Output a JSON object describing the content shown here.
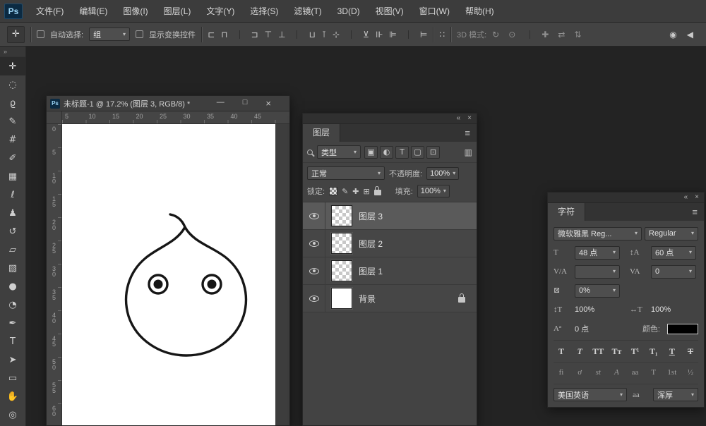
{
  "ui": {
    "caret": "▾",
    "collapse_icon": "«",
    "close_icon": "×",
    "menu_icon": "≡",
    "toolbar_collapse_icon": "»"
  },
  "menu_bar": {
    "logo": "Ps",
    "items": [
      {
        "label": "文件(F)",
        "dn": "menu-file"
      },
      {
        "label": "编辑(E)",
        "dn": "menu-edit"
      },
      {
        "label": "图像(I)",
        "dn": "menu-image"
      },
      {
        "label": "图层(L)",
        "dn": "menu-layer"
      },
      {
        "label": "文字(Y)",
        "dn": "menu-type"
      },
      {
        "label": "选择(S)",
        "dn": "menu-select"
      },
      {
        "label": "滤镜(T)",
        "dn": "menu-filter"
      },
      {
        "label": "3D(D)",
        "dn": "menu-3d"
      },
      {
        "label": "视图(V)",
        "dn": "menu-view"
      },
      {
        "label": "窗口(W)",
        "dn": "menu-window"
      },
      {
        "label": "帮助(H)",
        "dn": "menu-help"
      }
    ]
  },
  "options_bar": {
    "tool_icon": "✛",
    "auto_select_label": "自动选择:",
    "auto_select_value": "组",
    "show_transform_label": "显示变换控件",
    "align_icons": [
      {
        "glyph": "⊏",
        "dn": "align-left-edges-icon"
      },
      {
        "glyph": "⊓",
        "dn": "align-horizontal-centers-icon"
      },
      {
        "glyph": "⊐",
        "dn": "align-right-edges-icon"
      },
      {
        "glyph": "⊤",
        "dn": "align-top-edges-icon"
      },
      {
        "glyph": "⊥",
        "dn": "align-vertical-centers-icon"
      },
      {
        "glyph": "⊔",
        "dn": "align-bottom-edges-icon"
      },
      {
        "glyph": "⊺",
        "dn": "distribute-top-edges-icon"
      },
      {
        "glyph": "⊹",
        "dn": "distribute-vertical-centers-icon"
      },
      {
        "glyph": "⊻",
        "dn": "distribute-bottom-edges-icon"
      },
      {
        "glyph": "⊪",
        "dn": "distribute-left-edges-icon"
      },
      {
        "glyph": "⊫",
        "dn": "distribute-horizontal-centers-icon"
      },
      {
        "glyph": "⊨",
        "dn": "distribute-right-edges-icon"
      }
    ],
    "auto_align_icon": "∷",
    "mode_3d_label": "3D 模式:",
    "mode_3d_icons": [
      {
        "glyph": "↻",
        "dn": "3d-rotate-icon"
      },
      {
        "glyph": "⊙",
        "dn": "3d-roll-icon"
      },
      {
        "glyph": "✚",
        "dn": "3d-drag-icon"
      },
      {
        "glyph": "⇄",
        "dn": "3d-slide-icon"
      },
      {
        "glyph": "⇅",
        "dn": "3d-scale-icon"
      }
    ],
    "extra_icons": [
      {
        "glyph": "◉",
        "dn": "options-bar-extra-icon-1"
      },
      {
        "glyph": "◀",
        "dn": "options-bar-extra-icon-2"
      }
    ]
  },
  "toolbar": {
    "tools": [
      {
        "glyph": "✛",
        "dn": "move-tool",
        "cls": "active"
      },
      {
        "glyph": "◌",
        "dn": "elliptical-marquee-tool"
      },
      {
        "glyph": "ϱ",
        "dn": "lasso-tool"
      },
      {
        "glyph": "✎",
        "dn": "quick-selection-tool"
      },
      {
        "glyph": "#",
        "dn": "crop-tool"
      },
      {
        "glyph": "✐",
        "dn": "eyedropper-tool"
      },
      {
        "glyph": "▦",
        "dn": "spot-healing-brush-tool"
      },
      {
        "glyph": "ℓ",
        "dn": "brush-tool"
      },
      {
        "glyph": "♟",
        "dn": "clone-stamp-tool"
      },
      {
        "glyph": "↺",
        "dn": "history-brush-tool"
      },
      {
        "glyph": "▱",
        "dn": "eraser-tool"
      },
      {
        "glyph": "▧",
        "dn": "gradient-tool"
      },
      {
        "glyph": "●",
        "dn": "blur-tool"
      },
      {
        "glyph": "◔",
        "dn": "dodge-tool"
      },
      {
        "glyph": "✒",
        "dn": "pen-tool"
      },
      {
        "glyph": "T",
        "dn": "type-tool"
      },
      {
        "glyph": "➤",
        "dn": "path-selection-tool"
      },
      {
        "glyph": "▭",
        "dn": "rectangle-tool"
      },
      {
        "glyph": "✋",
        "dn": "hand-tool"
      },
      {
        "glyph": "◎",
        "dn": "zoom-tool"
      }
    ]
  },
  "document": {
    "icon": "Ps",
    "title": "未标题-1 @ 17.2% (图层 3, RGB/8) *",
    "minimize_icon": "—",
    "maximize_icon": "□",
    "close_icon": "×",
    "h_ruler": [
      "5",
      "10",
      "15",
      "20",
      "25",
      "30",
      "35",
      "40",
      "45"
    ],
    "v_ruler": [
      "0",
      "5",
      "10",
      "15",
      "20",
      "25",
      "30",
      "35",
      "40",
      "45",
      "50",
      "55",
      "60"
    ]
  },
  "layers_panel": {
    "tab": "图层",
    "filter_label": "类型",
    "filter_icons": [
      {
        "glyph": "▣",
        "dn": "filter-pixel-layers-icon"
      },
      {
        "glyph": "◐",
        "dn": "filter-adjustment-layers-icon"
      },
      {
        "glyph": "T",
        "dn": "filter-type-layers-icon"
      },
      {
        "glyph": "▢",
        "dn": "filter-shape-layers-icon"
      },
      {
        "glyph": "⊡",
        "dn": "filter-smart-objects-icon"
      }
    ],
    "filter_toggle_icon": "▥",
    "blend_mode": "正常",
    "opacity_label": "不透明度:",
    "opacity_value": "100%",
    "lock_label": "锁定:",
    "lock_icons": [
      {
        "glyph": "✎",
        "dn": "lock-image-pixels-icon"
      },
      {
        "glyph": "✚",
        "dn": "lock-position-icon"
      },
      {
        "glyph": "⊞",
        "dn": "lock-artboard-icon"
      }
    ],
    "fill_label": "填充:",
    "fill_value": "100%",
    "layers": [
      {
        "label": "图层 3",
        "cls": "selected"
      },
      {
        "label": "图层 2"
      },
      {
        "label": "图层 1"
      },
      {
        "label": "背景",
        "cls": "bg",
        "locked": true
      }
    ]
  },
  "char_panel": {
    "tab": "字符",
    "font_family": "微软雅黑 Reg...",
    "font_style": "Regular",
    "size_icon": "T",
    "size_value": "48 点",
    "leading_icon": "↕A",
    "leading_value": "60 点",
    "kerning_icon": "V/A",
    "kerning_value": "",
    "tracking_icon": "VA",
    "tracking_value": "0",
    "tsume_icon": "⊠",
    "tsume_value": "0%",
    "vscale_icon": "↕T",
    "vscale_value": "100%",
    "hscale_icon": "↔T",
    "hscale_value": "100%",
    "baseline_icon": "Aª",
    "baseline_value": "0 点",
    "color_label": "颜色:",
    "color_value": "#000000",
    "style_buttons": [
      {
        "glyph": "T",
        "dn": "faux-bold-button",
        "cls": "b"
      },
      {
        "glyph": "T",
        "dn": "faux-italic-button",
        "cls": "i"
      },
      {
        "glyph": "TT",
        "dn": "all-caps-button"
      },
      {
        "glyph": "Tт",
        "dn": "small-caps-button"
      },
      {
        "glyph": "T¹",
        "dn": "superscript-button"
      },
      {
        "glyph": "T₁",
        "dn": "subscript-button"
      },
      {
        "glyph": "T",
        "dn": "underline-button",
        "cls": "u"
      },
      {
        "glyph": "T",
        "dn": "strikethrough-button",
        "cls": "s"
      }
    ],
    "opentype_buttons": [
      {
        "glyph": "fi",
        "dn": "standard-ligatures-button",
        "cls": "obtn"
      },
      {
        "glyph": "ơ",
        "dn": "contextual-alternates-button",
        "cls": "obtn"
      },
      {
        "glyph": "st",
        "dn": "discretionary-ligatures-button",
        "cls": "obtn i"
      },
      {
        "glyph": "A",
        "dn": "swash-button",
        "cls": "obtn i"
      },
      {
        "glyph": "aa",
        "dn": "stylistic-alternates-button",
        "cls": "obtn"
      },
      {
        "glyph": "T",
        "dn": "titling-alternates-button",
        "cls": "obtn"
      },
      {
        "glyph": "1st",
        "dn": "ordinals-button",
        "cls": "obtn"
      },
      {
        "glyph": "½",
        "dn": "fractions-button",
        "cls": "obtn"
      }
    ],
    "language_value": "美国英语",
    "antialias_icon": "aa",
    "antialias_value": "浑厚"
  }
}
